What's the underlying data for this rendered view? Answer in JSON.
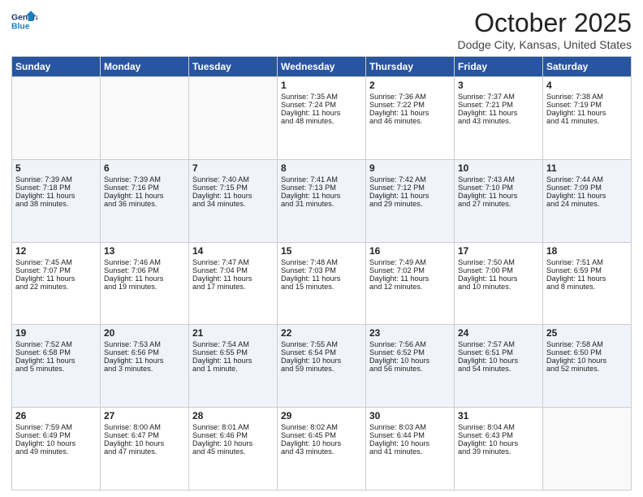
{
  "header": {
    "logo_line1": "General",
    "logo_line2": "Blue",
    "month": "October 2025",
    "location": "Dodge City, Kansas, United States"
  },
  "days_of_week": [
    "Sunday",
    "Monday",
    "Tuesday",
    "Wednesday",
    "Thursday",
    "Friday",
    "Saturday"
  ],
  "weeks": [
    [
      {
        "day": "",
        "info": ""
      },
      {
        "day": "",
        "info": ""
      },
      {
        "day": "",
        "info": ""
      },
      {
        "day": "1",
        "info": "Sunrise: 7:35 AM\nSunset: 7:24 PM\nDaylight: 11 hours\nand 48 minutes."
      },
      {
        "day": "2",
        "info": "Sunrise: 7:36 AM\nSunset: 7:22 PM\nDaylight: 11 hours\nand 46 minutes."
      },
      {
        "day": "3",
        "info": "Sunrise: 7:37 AM\nSunset: 7:21 PM\nDaylight: 11 hours\nand 43 minutes."
      },
      {
        "day": "4",
        "info": "Sunrise: 7:38 AM\nSunset: 7:19 PM\nDaylight: 11 hours\nand 41 minutes."
      }
    ],
    [
      {
        "day": "5",
        "info": "Sunrise: 7:39 AM\nSunset: 7:18 PM\nDaylight: 11 hours\nand 38 minutes."
      },
      {
        "day": "6",
        "info": "Sunrise: 7:39 AM\nSunset: 7:16 PM\nDaylight: 11 hours\nand 36 minutes."
      },
      {
        "day": "7",
        "info": "Sunrise: 7:40 AM\nSunset: 7:15 PM\nDaylight: 11 hours\nand 34 minutes."
      },
      {
        "day": "8",
        "info": "Sunrise: 7:41 AM\nSunset: 7:13 PM\nDaylight: 11 hours\nand 31 minutes."
      },
      {
        "day": "9",
        "info": "Sunrise: 7:42 AM\nSunset: 7:12 PM\nDaylight: 11 hours\nand 29 minutes."
      },
      {
        "day": "10",
        "info": "Sunrise: 7:43 AM\nSunset: 7:10 PM\nDaylight: 11 hours\nand 27 minutes."
      },
      {
        "day": "11",
        "info": "Sunrise: 7:44 AM\nSunset: 7:09 PM\nDaylight: 11 hours\nand 24 minutes."
      }
    ],
    [
      {
        "day": "12",
        "info": "Sunrise: 7:45 AM\nSunset: 7:07 PM\nDaylight: 11 hours\nand 22 minutes."
      },
      {
        "day": "13",
        "info": "Sunrise: 7:46 AM\nSunset: 7:06 PM\nDaylight: 11 hours\nand 19 minutes."
      },
      {
        "day": "14",
        "info": "Sunrise: 7:47 AM\nSunset: 7:04 PM\nDaylight: 11 hours\nand 17 minutes."
      },
      {
        "day": "15",
        "info": "Sunrise: 7:48 AM\nSunset: 7:03 PM\nDaylight: 11 hours\nand 15 minutes."
      },
      {
        "day": "16",
        "info": "Sunrise: 7:49 AM\nSunset: 7:02 PM\nDaylight: 11 hours\nand 12 minutes."
      },
      {
        "day": "17",
        "info": "Sunrise: 7:50 AM\nSunset: 7:00 PM\nDaylight: 11 hours\nand 10 minutes."
      },
      {
        "day": "18",
        "info": "Sunrise: 7:51 AM\nSunset: 6:59 PM\nDaylight: 11 hours\nand 8 minutes."
      }
    ],
    [
      {
        "day": "19",
        "info": "Sunrise: 7:52 AM\nSunset: 6:58 PM\nDaylight: 11 hours\nand 5 minutes."
      },
      {
        "day": "20",
        "info": "Sunrise: 7:53 AM\nSunset: 6:56 PM\nDaylight: 11 hours\nand 3 minutes."
      },
      {
        "day": "21",
        "info": "Sunrise: 7:54 AM\nSunset: 6:55 PM\nDaylight: 11 hours\nand 1 minute."
      },
      {
        "day": "22",
        "info": "Sunrise: 7:55 AM\nSunset: 6:54 PM\nDaylight: 10 hours\nand 59 minutes."
      },
      {
        "day": "23",
        "info": "Sunrise: 7:56 AM\nSunset: 6:52 PM\nDaylight: 10 hours\nand 56 minutes."
      },
      {
        "day": "24",
        "info": "Sunrise: 7:57 AM\nSunset: 6:51 PM\nDaylight: 10 hours\nand 54 minutes."
      },
      {
        "day": "25",
        "info": "Sunrise: 7:58 AM\nSunset: 6:50 PM\nDaylight: 10 hours\nand 52 minutes."
      }
    ],
    [
      {
        "day": "26",
        "info": "Sunrise: 7:59 AM\nSunset: 6:49 PM\nDaylight: 10 hours\nand 49 minutes."
      },
      {
        "day": "27",
        "info": "Sunrise: 8:00 AM\nSunset: 6:47 PM\nDaylight: 10 hours\nand 47 minutes."
      },
      {
        "day": "28",
        "info": "Sunrise: 8:01 AM\nSunset: 6:46 PM\nDaylight: 10 hours\nand 45 minutes."
      },
      {
        "day": "29",
        "info": "Sunrise: 8:02 AM\nSunset: 6:45 PM\nDaylight: 10 hours\nand 43 minutes."
      },
      {
        "day": "30",
        "info": "Sunrise: 8:03 AM\nSunset: 6:44 PM\nDaylight: 10 hours\nand 41 minutes."
      },
      {
        "day": "31",
        "info": "Sunrise: 8:04 AM\nSunset: 6:43 PM\nDaylight: 10 hours\nand 39 minutes."
      },
      {
        "day": "",
        "info": ""
      }
    ]
  ]
}
